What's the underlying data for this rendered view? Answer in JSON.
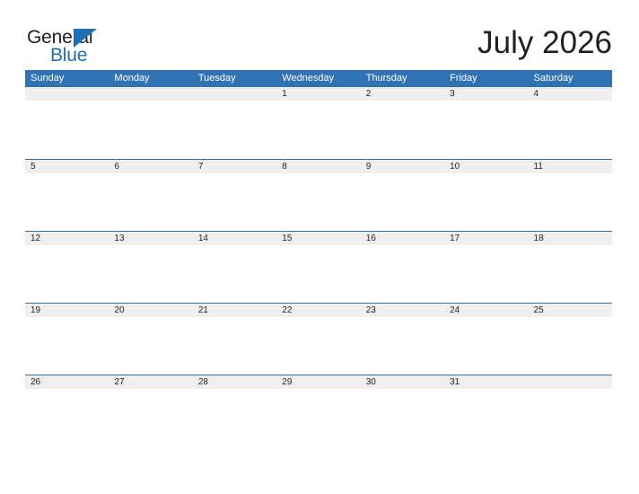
{
  "brand": {
    "name_part_1": "General",
    "name_part_2": "Blue",
    "flag_icon": "blue-triangle-flag-icon",
    "color_dark": "#231f20",
    "color_blue": "#1f6fb5"
  },
  "header": {
    "title": "July 2026"
  },
  "theme": {
    "header_bar_blue": "#2f73b4",
    "row_rule_blue": "#2f73b4",
    "date_band_gray": "#efefef",
    "text_dark": "#231f20",
    "page_background": "#ffffff"
  },
  "calendar": {
    "month": "July",
    "year": "2026",
    "weekday_headers": [
      "Sunday",
      "Monday",
      "Tuesday",
      "Wednesday",
      "Thursday",
      "Friday",
      "Saturday"
    ],
    "weeks": [
      {
        "has_top_rule": false,
        "days": [
          "",
          "",
          "",
          "1",
          "2",
          "3",
          "4"
        ]
      },
      {
        "has_top_rule": true,
        "days": [
          "5",
          "6",
          "7",
          "8",
          "9",
          "10",
          "11"
        ]
      },
      {
        "has_top_rule": true,
        "days": [
          "12",
          "13",
          "14",
          "15",
          "16",
          "17",
          "18"
        ]
      },
      {
        "has_top_rule": true,
        "days": [
          "19",
          "20",
          "21",
          "22",
          "23",
          "24",
          "25"
        ]
      },
      {
        "has_top_rule": true,
        "days": [
          "26",
          "27",
          "28",
          "29",
          "30",
          "31",
          ""
        ]
      }
    ]
  }
}
